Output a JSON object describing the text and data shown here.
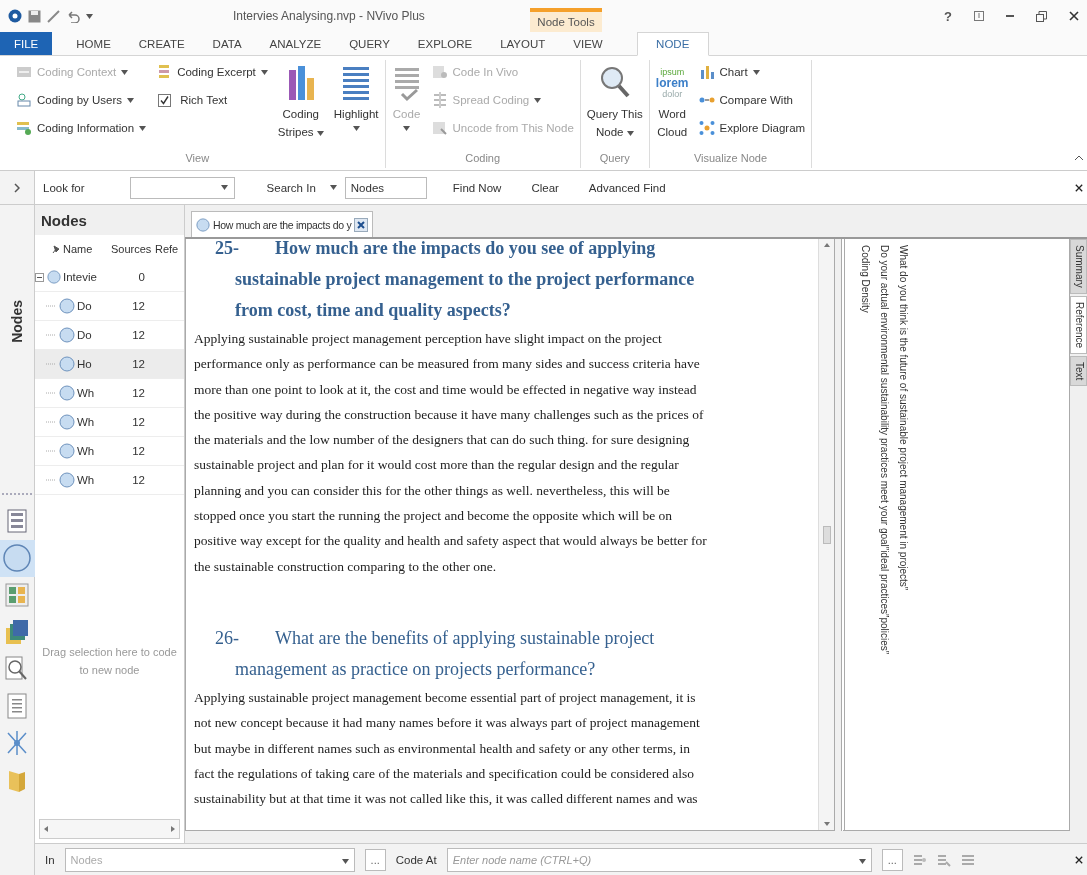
{
  "window": {
    "title": "Intervies Analysing.nvp - NVivo Plus",
    "help": "?"
  },
  "ribbon_tabs": [
    {
      "label": "FILE",
      "kind": "file",
      "selected": false
    },
    {
      "label": "HOME",
      "kind": "tab",
      "selected": false
    },
    {
      "label": "CREATE",
      "kind": "tab",
      "selected": false
    },
    {
      "label": "DATA",
      "kind": "tab",
      "selected": false
    },
    {
      "label": "ANALYZE",
      "kind": "tab",
      "selected": false
    },
    {
      "label": "QUERY",
      "kind": "tab",
      "selected": false
    },
    {
      "label": "EXPLORE",
      "kind": "tab",
      "selected": false
    },
    {
      "label": "LAYOUT",
      "kind": "tab",
      "selected": false
    },
    {
      "label": "VIEW",
      "kind": "tab",
      "selected": false
    },
    {
      "label": "NODE",
      "kind": "context",
      "context": "Node Tools",
      "selected": true
    }
  ],
  "ribbon_groups": [
    {
      "label": "View",
      "items": [
        {
          "kind": "small",
          "label": "Coding Context",
          "dropdown": true,
          "disabled": true
        },
        {
          "kind": "small",
          "label": "Coding by Users",
          "dropdown": true,
          "disabled": false
        },
        {
          "kind": "small",
          "label": "Coding Information",
          "dropdown": true,
          "disabled": false
        },
        {
          "kind": "small",
          "label": "Coding Excerpt",
          "dropdown": true,
          "disabled": false
        },
        {
          "kind": "check",
          "label": "Rich Text",
          "checked": true,
          "disabled": false
        },
        {
          "kind": "large",
          "lines": [
            "Coding",
            "Stripes"
          ],
          "dropdown": true,
          "disabled": false
        },
        {
          "kind": "large",
          "lines": [
            "Highlight"
          ],
          "dropdown": true,
          "disabled": false
        }
      ]
    },
    {
      "label": "Coding",
      "items": [
        {
          "kind": "large",
          "lines": [
            "Code"
          ],
          "dropdown": true,
          "disabled": true
        },
        {
          "kind": "small",
          "label": "Code In Vivo",
          "dropdown": false,
          "disabled": true
        },
        {
          "kind": "small",
          "label": "Spread Coding",
          "dropdown": true,
          "disabled": true
        },
        {
          "kind": "small",
          "label": "Uncode from This Node",
          "dropdown": false,
          "disabled": true
        }
      ]
    },
    {
      "label": "Query",
      "items": [
        {
          "kind": "large",
          "lines": [
            "Query This",
            "Node"
          ],
          "dropdown": true,
          "disabled": false
        }
      ]
    },
    {
      "label": "Visualize Node",
      "items": [
        {
          "kind": "large",
          "lines": [
            "Word",
            "Cloud"
          ],
          "dropdown": false,
          "disabled": false,
          "icon_words": [
            "ipsum",
            "lorem",
            "dolor"
          ]
        },
        {
          "kind": "small",
          "label": "Chart",
          "dropdown": true,
          "disabled": false
        },
        {
          "kind": "small",
          "label": "Compare With",
          "dropdown": false,
          "disabled": false
        },
        {
          "kind": "small",
          "label": "Explore Diagram",
          "dropdown": false,
          "disabled": false
        }
      ]
    }
  ],
  "find_bar": {
    "look_for_label": "Look for",
    "search_in": "Search In",
    "search_scope": "Nodes",
    "buttons": [
      "Find Now",
      "Clear",
      "Advanced Find"
    ]
  },
  "navigation": {
    "title": "Nodes",
    "views": [
      {
        "selected": false
      },
      {
        "selected": true
      },
      {
        "selected": false
      },
      {
        "selected": false
      },
      {
        "selected": false
      },
      {
        "selected": false
      },
      {
        "selected": false
      },
      {
        "selected": false
      }
    ]
  },
  "nodes_panel": {
    "title": "Nodes",
    "columns": [
      "Name",
      "Sources",
      "Refe"
    ],
    "tree": [
      {
        "name": "Intevie",
        "sources": "0",
        "expanded": true,
        "selected": false,
        "children": [
          {
            "name": "Do",
            "sources": "12",
            "selected": false
          },
          {
            "name": "Do",
            "sources": "12",
            "selected": false
          },
          {
            "name": "Ho",
            "sources": "12",
            "selected": true
          },
          {
            "name": "Wh",
            "sources": "12",
            "selected": false
          },
          {
            "name": "Wh",
            "sources": "12",
            "selected": false
          },
          {
            "name": "Wh",
            "sources": "12",
            "selected": false
          },
          {
            "name": "Wh",
            "sources": "12",
            "selected": false
          }
        ]
      }
    ],
    "drop_hint": "Drag selection here to code to new node"
  },
  "document": {
    "tab": "How much are the impacts do y",
    "blocks": [
      {
        "kind": "heading",
        "number": "25-",
        "text": "How much are the impacts do you see of applying sustainable project management to the project performance from cost, time and quality aspects?",
        "bold": true
      },
      {
        "kind": "paragraph",
        "text": "Applying sustainable project management perception have slight impact on the project performance only as performance can be measured from many sides and success criteria have more than one point to look at it, the cost and time would be effected in negative way instead the positive way during the construction because it have many challenges such as the prices of the materials and the low number of the designers that can do such thing. for sure designing sustainable project and plan for it would cost more than the regular design and the regular planning and you can consider this for the other things as well. nevertheless, this will be stopped once you start the running the project and become the opposite which will be on positive way except for the quality and health and safety aspect that would always be better for the sustainable construction comparing to the other one."
      },
      {
        "kind": "heading",
        "number": "26-",
        "text": "What are the benefits of applying sustainable project management as practice on projects performance?",
        "bold": false
      },
      {
        "kind": "paragraph",
        "text": "Applying sustainable project management become essential part of project management, it is not new concept because it had many names before it was always part of project management but maybe in different names such as environmental health and safety or any other terms, in fact the regulations of taking care of the materials and specification could be considered also sustainability but at that time it was not called like this, it was called different names and was"
      }
    ]
  },
  "coding_stripes": {
    "density_label": "Coding Density",
    "stripes": [
      "Do your actual environmental sustainability practices meet your goal”ideal practices”policies”",
      "What do you think is the future of sustainable project management in projects”"
    ]
  },
  "side_tabs": [
    {
      "label": "Summary",
      "selected": false
    },
    {
      "label": "Reference",
      "selected": true
    },
    {
      "label": "Text",
      "selected": false
    }
  ],
  "code_bar": {
    "in_label": "In",
    "in_placeholder": "Nodes",
    "in_browse": "...",
    "code_at_label": "Code At",
    "node_placeholder": "Enter node name (CTRL+Q)",
    "code_at_browse": "..."
  }
}
